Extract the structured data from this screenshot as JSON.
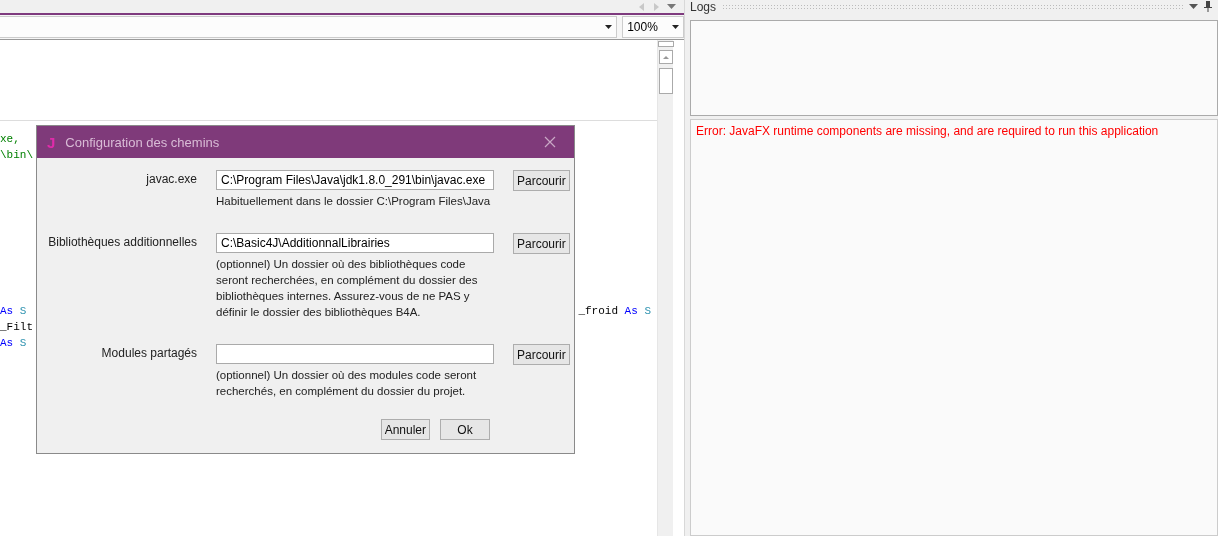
{
  "toolbar": {
    "zoom": "100%"
  },
  "code_blocks": [
    {
      "lines": [
        {
          "left": [
            {
              "kind": "string",
              "text": "xe,"
            }
          ]
        },
        {
          "left": [
            {
              "kind": "string",
              "text": "\\bin\\"
            }
          ]
        }
      ]
    },
    {
      "lines": [
        {
          "left": [
            {
              "kind": "keyword",
              "text": "As"
            },
            {
              "kind": "type",
              "text": "S"
            }
          ],
          "right": [
            {
              "kind": "plain",
              "text": "_froid"
            },
            {
              "kind": "keyword",
              "text": "As"
            },
            {
              "kind": "type",
              "text": "S"
            }
          ]
        },
        {
          "left": [
            {
              "kind": "plain",
              "text": "_Filt"
            }
          ]
        },
        {
          "left": [
            {
              "kind": "keyword",
              "text": "As"
            },
            {
              "kind": "type",
              "text": "S"
            }
          ]
        }
      ]
    }
  ],
  "dialog": {
    "icon_letter": "J",
    "title": "Configuration des chemins",
    "rows": [
      {
        "label": "javac.exe",
        "value": "C:\\Program Files\\Java\\jdk1.8.0_291\\bin\\javac.exe",
        "button": "Parcourir",
        "hint": "Habituellement dans le dossier C:\\Program Files\\Java"
      },
      {
        "label": "Bibliothèques additionnelles",
        "value": "C:\\Basic4J\\AdditionnalLibrairies",
        "button": "Parcourir",
        "hint": "(optionnel) Un dossier où des bibliothèques code seront recherchées, en complément du dossier des bibliothèques internes. Assurez-vous de ne PAS y définir le dossier des bibliothèques B4A."
      },
      {
        "label": "Modules partagés",
        "value": "",
        "button": "Parcourir",
        "hint": "(optionnel) Un dossier où des modules code seront recherchés, en complément du dossier du projet."
      }
    ],
    "buttons": [
      "Annuler",
      "Ok"
    ]
  },
  "logs": {
    "title": "Logs",
    "messages": [
      {
        "kind": "error",
        "text": "Error: JavaFX runtime components are missing, and are required to run this application"
      }
    ]
  }
}
